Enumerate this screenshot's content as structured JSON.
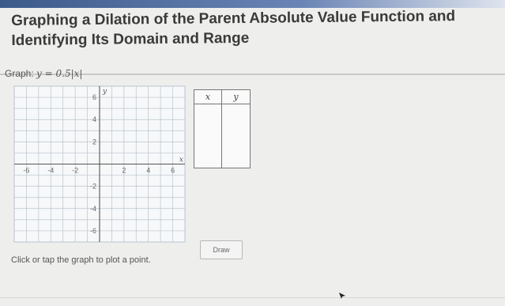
{
  "title": {
    "line1": "Graphing a Dilation of the Parent Absolute Value Function and",
    "line2": "Identifying Its Domain and Range"
  },
  "prompt": {
    "label": "Graph:",
    "equation": "y = 0.5|x|"
  },
  "graph": {
    "x_label": "x",
    "y_label": "y",
    "x_ticks": [
      "-6",
      "-4",
      "-2",
      "2",
      "4",
      "6"
    ],
    "y_ticks": [
      "6",
      "4",
      "2",
      "-2",
      "-4",
      "-6"
    ],
    "x_range": [
      -7,
      7
    ],
    "y_range": [
      -7,
      7
    ],
    "grid": true
  },
  "table": {
    "col_x": "x",
    "col_y": "y"
  },
  "draw_button": "Draw",
  "instruction": "Click or tap the graph to plot a point.",
  "colors": {
    "grid": "#b9c4cf",
    "axis": "#555555",
    "topbar": "#3c5a8a"
  }
}
